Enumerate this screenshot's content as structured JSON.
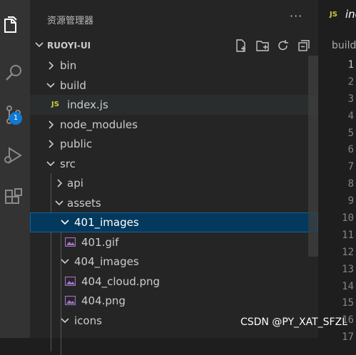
{
  "explorer": {
    "title": "资源管理器",
    "more": "···",
    "project": "RUOYI-UI"
  },
  "tree": [
    {
      "label": "bin",
      "kind": "folder-collapsed",
      "depth": 0
    },
    {
      "label": "build",
      "kind": "folder-expanded",
      "depth": 0
    },
    {
      "label": "index.js",
      "kind": "js",
      "depth": 1
    },
    {
      "label": "node_modules",
      "kind": "folder-collapsed",
      "depth": 0
    },
    {
      "label": "public",
      "kind": "folder-collapsed",
      "depth": 0
    },
    {
      "label": "src",
      "kind": "folder-expanded",
      "depth": 0
    },
    {
      "label": "api",
      "kind": "folder-collapsed",
      "depth": 1
    },
    {
      "label": "assets",
      "kind": "folder-expanded",
      "depth": 1
    },
    {
      "label": "401_images",
      "kind": "folder-expanded",
      "depth": 2
    },
    {
      "label": "401.gif",
      "kind": "image",
      "depth": 3
    },
    {
      "label": "404_images",
      "kind": "folder-expanded",
      "depth": 2
    },
    {
      "label": "404_cloud.png",
      "kind": "image",
      "depth": 3
    },
    {
      "label": "404.png",
      "kind": "image",
      "depth": 3
    },
    {
      "label": "icons",
      "kind": "folder-expanded",
      "depth": 2
    }
  ],
  "editor": {
    "tab_js_badge": "JS",
    "tab_label": "inc",
    "breadcrumb": "build",
    "line_numbers": [
      "1",
      "2",
      "3",
      "4",
      "5",
      "6",
      "7",
      "8",
      "9",
      "10",
      "11",
      "12",
      "13",
      "14",
      "15",
      "16",
      "17"
    ]
  },
  "js_badge": "JS",
  "source_control_badge": "1",
  "watermark": "CSDN @PY_XAT_SFZL",
  "colors": {
    "activity_bar": "#333333",
    "sidebar": "#252526",
    "selection": "#04395e",
    "selection_border": "#0e639c",
    "js_yellow": "#cbcb41",
    "badge_blue": "#0e7ad3"
  }
}
